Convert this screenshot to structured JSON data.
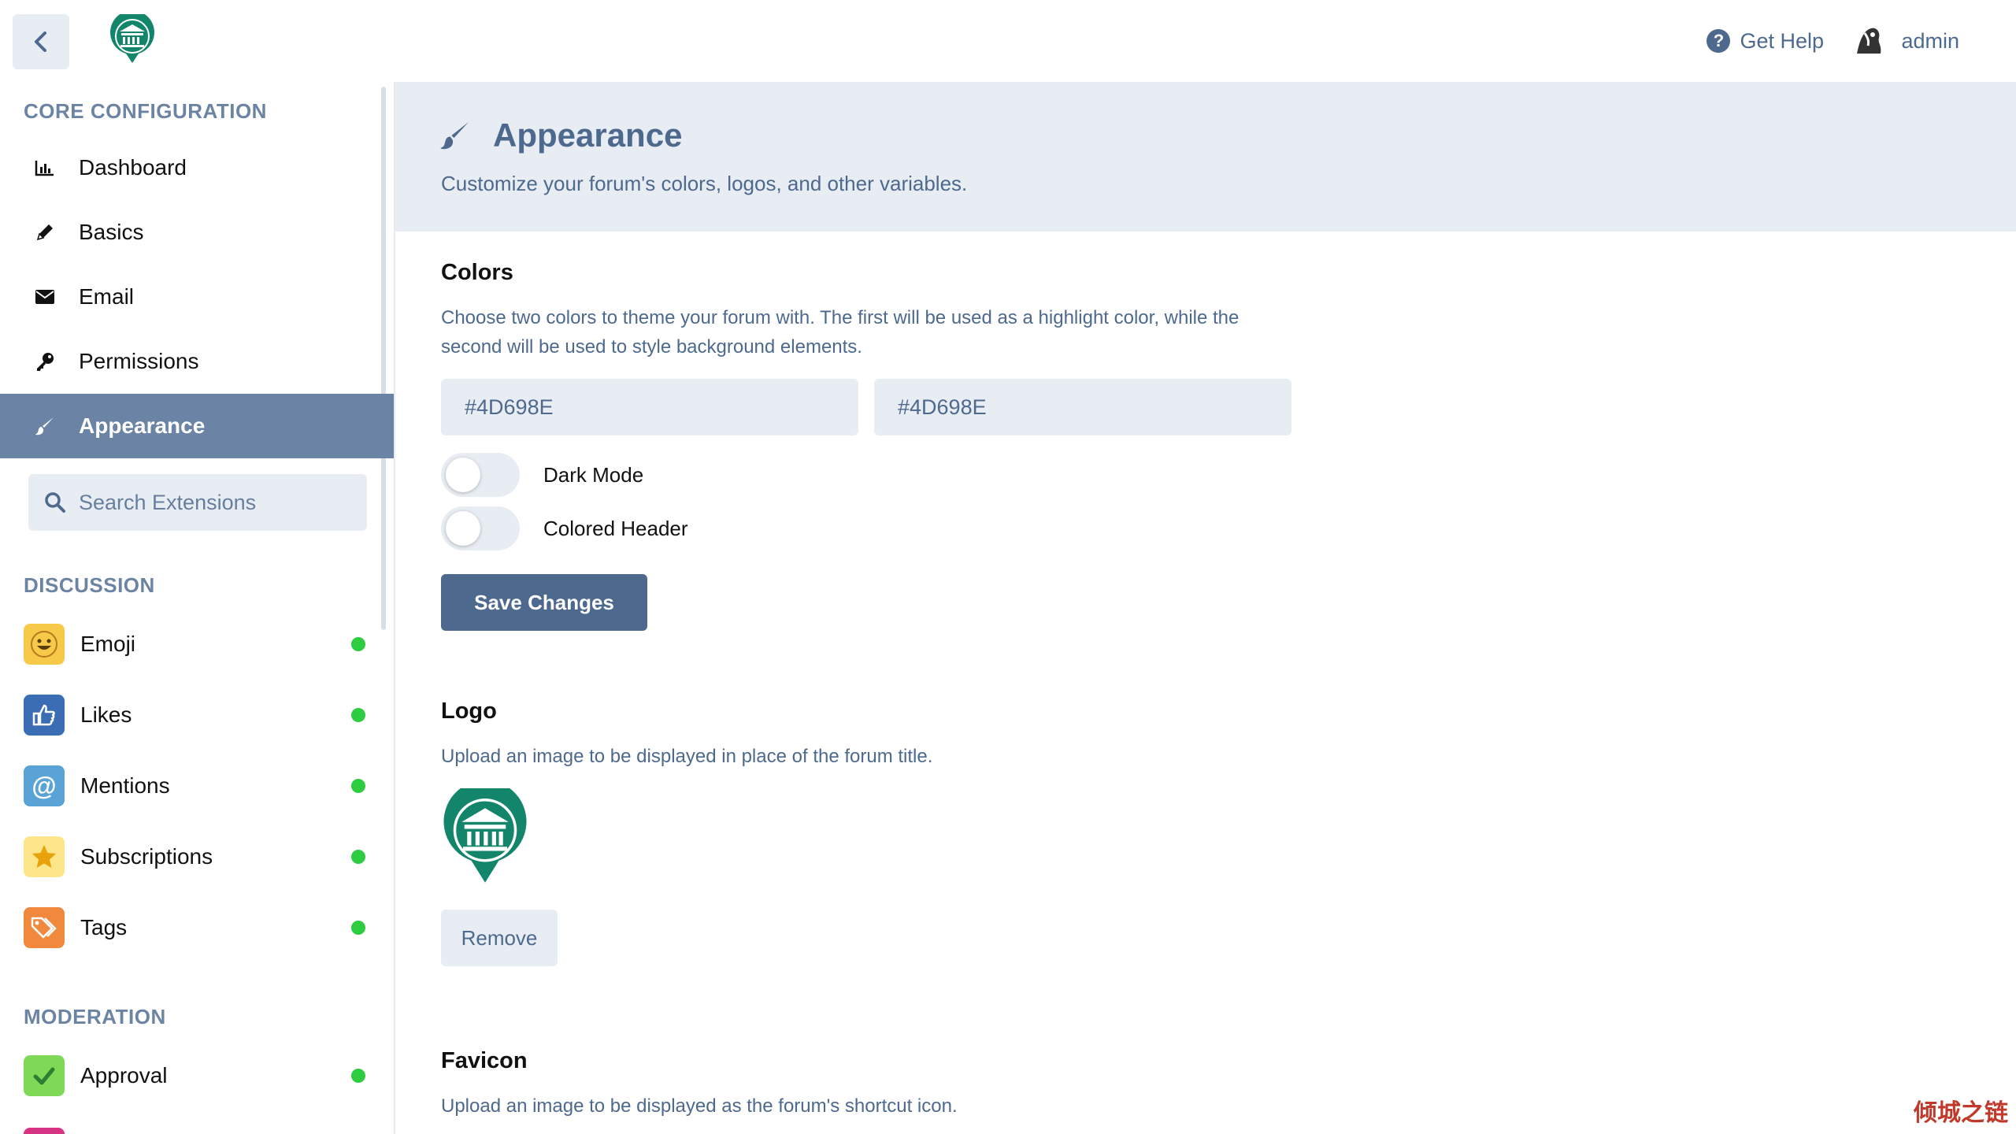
{
  "header": {
    "get_help": "Get Help",
    "username": "admin"
  },
  "sidebar": {
    "core_title": "CORE CONFIGURATION",
    "core_items": [
      {
        "label": "Dashboard",
        "icon": "chart-icon"
      },
      {
        "label": "Basics",
        "icon": "pencil-icon"
      },
      {
        "label": "Email",
        "icon": "envelope-icon"
      },
      {
        "label": "Permissions",
        "icon": "key-icon"
      },
      {
        "label": "Appearance",
        "icon": "paintbrush-icon",
        "active": true
      }
    ],
    "search_placeholder": "Search Extensions",
    "discussion_title": "DISCUSSION",
    "discussion_items": [
      {
        "label": "Emoji",
        "icon": "emoji-icon",
        "color": "#f7c948",
        "enabled": true
      },
      {
        "label": "Likes",
        "icon": "thumbs-up-icon",
        "color": "#3b6db5",
        "enabled": true
      },
      {
        "label": "Mentions",
        "icon": "at-icon",
        "color": "#5aa3d6",
        "enabled": true
      },
      {
        "label": "Subscriptions",
        "icon": "star-icon",
        "color": "#fde68a",
        "enabled": true
      },
      {
        "label": "Tags",
        "icon": "tags-icon",
        "color": "#f0883e",
        "enabled": true
      }
    ],
    "moderation_title": "MODERATION",
    "moderation_items": [
      {
        "label": "Approval",
        "icon": "check-icon",
        "color": "#7ed957",
        "enabled": true
      }
    ]
  },
  "hero": {
    "title": "Appearance",
    "subtitle": "Customize your forum's colors, logos, and other variables."
  },
  "colors": {
    "title": "Colors",
    "description": "Choose two colors to theme your forum with. The first will be used as a highlight color, while the second will be used to style background elements.",
    "primary_value": "#4D698E",
    "secondary_value": "#4D698E",
    "dark_mode_label": "Dark Mode",
    "dark_mode_on": false,
    "colored_header_label": "Colored Header",
    "colored_header_on": false,
    "save_label": "Save Changes"
  },
  "logo": {
    "title": "Logo",
    "description": "Upload an image to be displayed in place of the forum title.",
    "remove_label": "Remove"
  },
  "favicon": {
    "title": "Favicon",
    "description": "Upload an image to be displayed as the forum's shortcut icon."
  },
  "watermark": "倾城之链",
  "brand_color": "#12856b"
}
